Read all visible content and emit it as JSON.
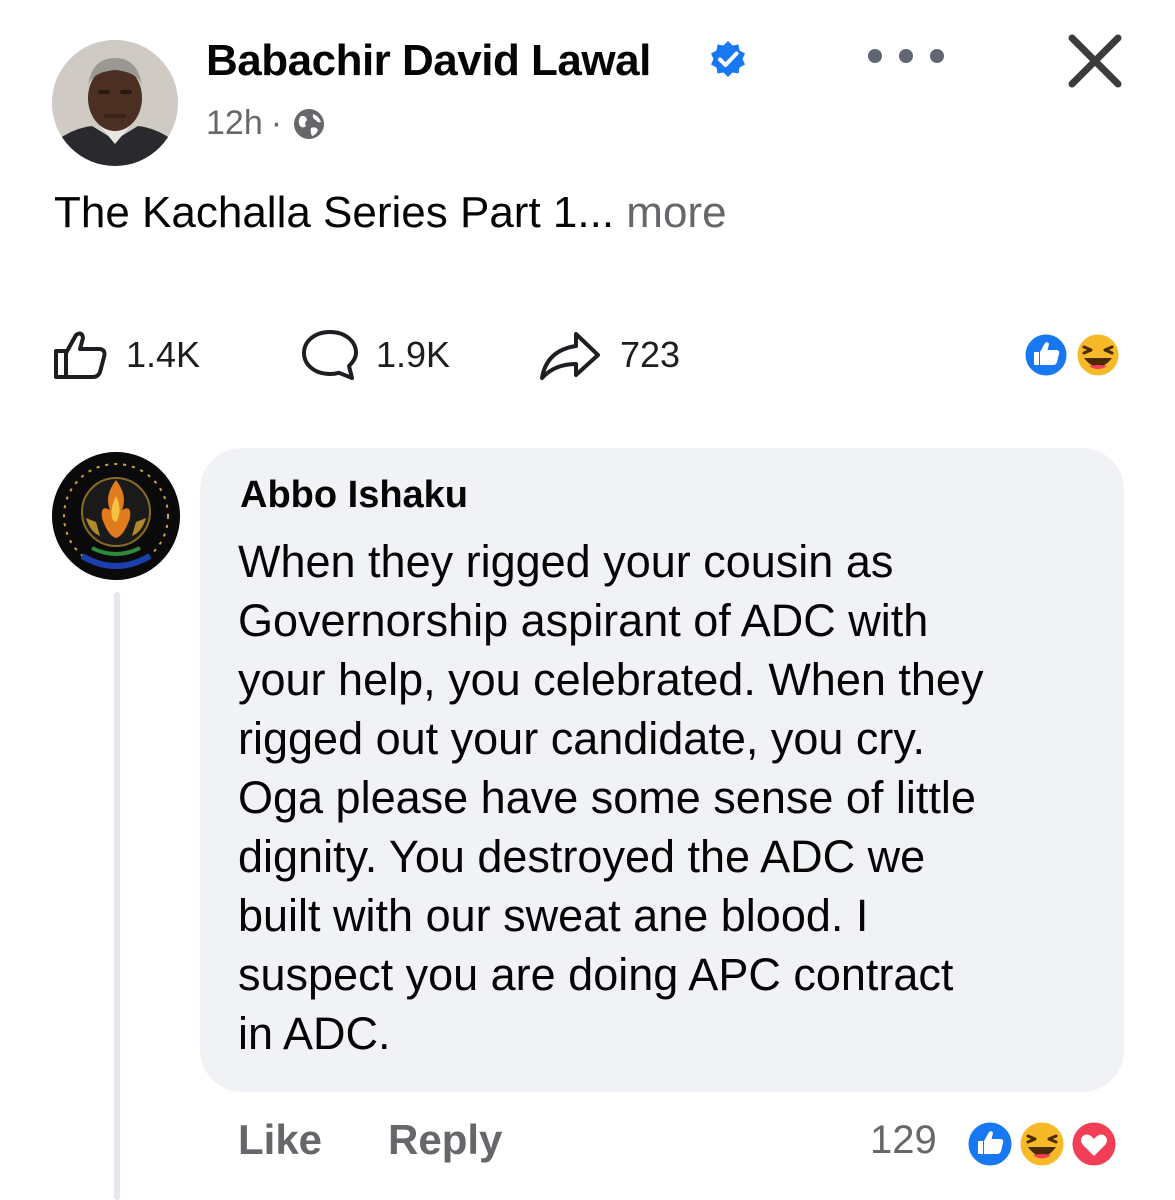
{
  "post": {
    "author": "Babachir David Lawal",
    "time": "12h",
    "separator": "·",
    "text": "The Kachalla Series Part 1...",
    "more_label": "more",
    "stats": {
      "likes": "1.4K",
      "comments": "1.9K",
      "shares": "723"
    },
    "reactions": [
      "like-icon",
      "haha-icon"
    ]
  },
  "comment": {
    "author": "Abbo Ishaku",
    "text": "When they rigged your cousin as\nGovernorship aspirant  of ADC with\nyour help, you celebrated. When they\nrigged out your candidate, you cry.\nOga please have some sense of little\ndignity. You destroyed the ADC we\nbuilt with our sweat ane blood. I\nsuspect you are doing APC contract\nin ADC.",
    "like_label": "Like",
    "reply_label": "Reply",
    "reaction_count": "129",
    "reactions": [
      "like-icon",
      "haha-icon",
      "love-icon"
    ]
  },
  "colors": {
    "facebook_blue": "#1877f2",
    "meta_gray": "#65676b",
    "bubble_bg": "#f0f2f5",
    "love_red": "#f33e58",
    "haha_yellow": "#f7b928"
  }
}
